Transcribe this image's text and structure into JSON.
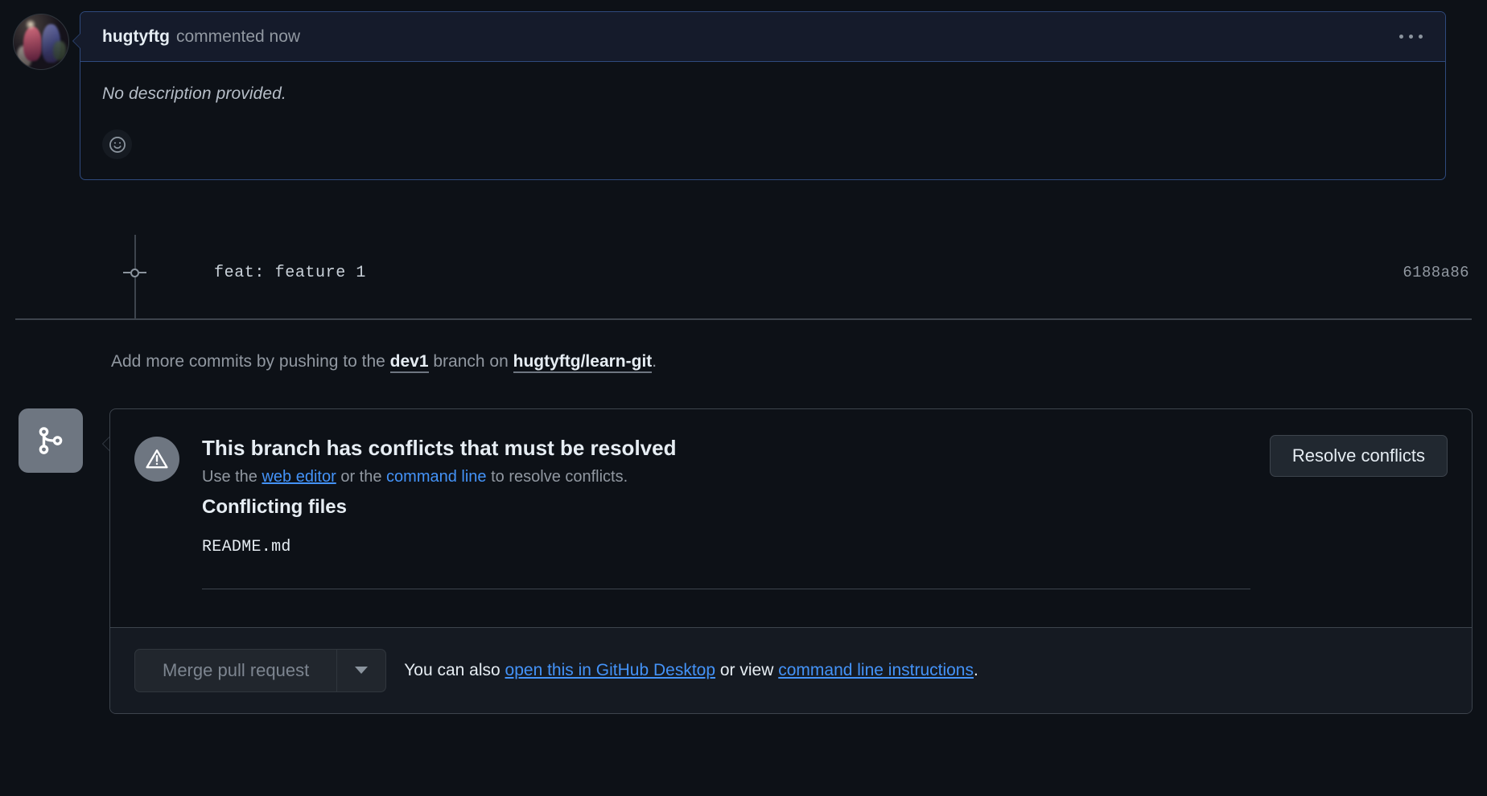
{
  "comment": {
    "author": "hugtyftg",
    "action": "commented now",
    "body": "No description provided.",
    "reaction_icon": "smiley-icon",
    "menu_icon": "kebab-horizontal-icon",
    "avatar_alt": "hugtyftg-avatar"
  },
  "commit": {
    "message": "feat: feature 1",
    "sha": "6188a86"
  },
  "push_hint": {
    "prefix": "Add more commits by pushing to the ",
    "branch": "dev1",
    "middle": " branch on ",
    "repo": "hugtyftg/learn-git",
    "suffix": "."
  },
  "conflict": {
    "badge_icon": "git-branch-icon",
    "warning_icon": "alert-triangle-icon",
    "title": "This branch has conflicts that must be resolved",
    "sub_prefix": "Use the ",
    "sub_link1": "web editor",
    "sub_middle": " or the ",
    "sub_link2": "command line",
    "sub_suffix": " to resolve conflicts.",
    "files_heading": "Conflicting files",
    "files": [
      "README.md"
    ],
    "resolve_button": "Resolve conflicts"
  },
  "footer": {
    "merge_button": "Merge pull request",
    "dropdown_icon": "chevron-down-icon",
    "text_prefix": "You can also ",
    "link1": "open this in GitHub Desktop",
    "text_middle": " or view ",
    "link2": "command line instructions",
    "text_suffix": "."
  },
  "colors": {
    "page_bg": "#0d1117",
    "comment_header_bg": "#151b2b",
    "comment_border": "#2f4a7d",
    "link_blue": "#4493f8",
    "muted": "#9198a1",
    "border_gray": "#3d444d"
  }
}
